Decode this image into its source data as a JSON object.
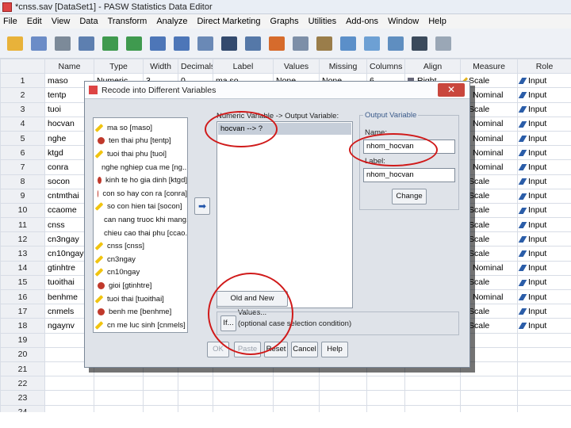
{
  "window": {
    "title": "*cnss.sav [DataSet1] - PASW Statistics Data Editor"
  },
  "menu": [
    "File",
    "Edit",
    "View",
    "Data",
    "Transform",
    "Analyze",
    "Direct Marketing",
    "Graphs",
    "Utilities",
    "Add-ons",
    "Window",
    "Help"
  ],
  "toolbar": {
    "icons": [
      "open-icon",
      "save-icon",
      "print-icon",
      "recall-dialog-icon",
      "undo-icon",
      "redo-icon",
      "goto-case-icon",
      "goto-variable-icon",
      "variables-icon",
      "find-icon",
      "insert-cases-icon",
      "insert-variable-icon",
      "split-file-icon",
      "weight-cases-icon",
      "select-cases-icon",
      "value-labels-icon",
      "use-sets-icon",
      "show-all-icon",
      "spelling-icon"
    ]
  },
  "grid": {
    "headers": [
      "",
      "Name",
      "Type",
      "Width",
      "Decimals",
      "Label",
      "Values",
      "Missing",
      "Columns",
      "Align",
      "Measure",
      "Role"
    ],
    "rows": [
      {
        "num": "1",
        "name": "maso",
        "type": "Numeric",
        "width": "3",
        "decimals": "0",
        "label": "ma so",
        "values": "None",
        "missing": "None",
        "columns": "6",
        "align": "Right",
        "measure": "Scale",
        "role": "Input"
      },
      {
        "num": "2",
        "name": "tentp",
        "type": "",
        "width": "",
        "decimals": "",
        "label": "",
        "values": "",
        "missing": "",
        "columns": "",
        "align": "",
        "measure": "Nominal",
        "role": "Input"
      },
      {
        "num": "3",
        "name": "tuoi",
        "type": "",
        "width": "",
        "decimals": "",
        "label": "",
        "values": "",
        "missing": "",
        "columns": "",
        "align": "",
        "measure": "Scale",
        "role": "Input"
      },
      {
        "num": "4",
        "name": "hocvan",
        "type": "",
        "width": "",
        "decimals": "",
        "label": "",
        "values": "",
        "missing": "",
        "columns": "",
        "align": "",
        "measure": "Nominal",
        "role": "Input"
      },
      {
        "num": "5",
        "name": "nghe",
        "type": "",
        "width": "",
        "decimals": "",
        "label": "",
        "values": "",
        "missing": "",
        "columns": "",
        "align": "",
        "measure": "Nominal",
        "role": "Input"
      },
      {
        "num": "6",
        "name": "ktgd",
        "type": "",
        "width": "",
        "decimals": "",
        "label": "",
        "values": "",
        "missing": "",
        "columns": "",
        "align": "",
        "measure": "Nominal",
        "role": "Input"
      },
      {
        "num": "7",
        "name": "conra",
        "type": "",
        "width": "",
        "decimals": "",
        "label": "",
        "values": "",
        "missing": "",
        "columns": "",
        "align": "",
        "measure": "Nominal",
        "role": "Input"
      },
      {
        "num": "8",
        "name": "socon",
        "type": "",
        "width": "",
        "decimals": "",
        "label": "",
        "values": "",
        "missing": "",
        "columns": "",
        "align": "",
        "measure": "Scale",
        "role": "Input"
      },
      {
        "num": "9",
        "name": "cntmthai",
        "type": "",
        "width": "",
        "decimals": "",
        "label": "",
        "values": "",
        "missing": "",
        "columns": "",
        "align": "",
        "measure": "Scale",
        "role": "Input"
      },
      {
        "num": "10",
        "name": "ccaome",
        "type": "",
        "width": "",
        "decimals": "",
        "label": "",
        "values": "",
        "missing": "",
        "columns": "",
        "align": "",
        "measure": "Scale",
        "role": "Input"
      },
      {
        "num": "11",
        "name": "cnss",
        "type": "",
        "width": "",
        "decimals": "",
        "label": "",
        "values": "",
        "missing": "",
        "columns": "",
        "align": "",
        "measure": "Scale",
        "role": "Input"
      },
      {
        "num": "12",
        "name": "cn3ngay",
        "type": "",
        "width": "",
        "decimals": "",
        "label": "",
        "values": "",
        "missing": "",
        "columns": "",
        "align": "",
        "measure": "Scale",
        "role": "Input"
      },
      {
        "num": "13",
        "name": "cn10ngay",
        "type": "",
        "width": "",
        "decimals": "",
        "label": "",
        "values": "",
        "missing": "",
        "columns": "",
        "align": "",
        "measure": "Scale",
        "role": "Input"
      },
      {
        "num": "14",
        "name": "gtinhtre",
        "type": "",
        "width": "",
        "decimals": "",
        "label": "",
        "values": "",
        "missing": "",
        "columns": "",
        "align": "",
        "measure": "Nominal",
        "role": "Input"
      },
      {
        "num": "15",
        "name": "tuoithai",
        "type": "",
        "width": "",
        "decimals": "",
        "label": "",
        "values": "",
        "missing": "",
        "columns": "",
        "align": "",
        "measure": "Scale",
        "role": "Input"
      },
      {
        "num": "16",
        "name": "benhme",
        "type": "",
        "width": "",
        "decimals": "",
        "label": "",
        "values": "",
        "missing": "",
        "columns": "",
        "align": "",
        "measure": "Nominal",
        "role": "Input"
      },
      {
        "num": "17",
        "name": "cnmels",
        "type": "",
        "width": "",
        "decimals": "",
        "label": "",
        "values": "",
        "missing": "",
        "columns": "",
        "align": "",
        "measure": "Scale",
        "role": "Input"
      },
      {
        "num": "18",
        "name": "ngaynv",
        "type": "",
        "width": "",
        "decimals": "",
        "label": "",
        "values": "",
        "missing": "",
        "columns": "",
        "align": "",
        "measure": "Scale",
        "role": "Input"
      },
      {
        "num": "19"
      },
      {
        "num": "20"
      },
      {
        "num": "21"
      },
      {
        "num": "22"
      },
      {
        "num": "23"
      },
      {
        "num": "24"
      }
    ]
  },
  "dialog": {
    "title": "Recode into Different Variables",
    "close_label": "✕",
    "variables": [
      {
        "label": "ma so [maso]",
        "measure": "scale"
      },
      {
        "label": "ten thai phu [tentp]",
        "measure": "nominal"
      },
      {
        "label": "tuoi thai phu [tuoi]",
        "measure": "scale"
      },
      {
        "label": "nghe nghiep cua me [ng...",
        "measure": "nominal"
      },
      {
        "label": "kinh te ho gia dinh [ktgd]",
        "measure": "nominal"
      },
      {
        "label": "con so hay con ra [conra]",
        "measure": "nominal"
      },
      {
        "label": "so con hien tai [socon]",
        "measure": "scale"
      },
      {
        "label": "can nang truoc khi mang...",
        "measure": "scale"
      },
      {
        "label": "chieu cao thai phu [ccao...",
        "measure": "scale"
      },
      {
        "label": "cnss [cnss]",
        "measure": "scale"
      },
      {
        "label": "cn3ngay",
        "measure": "scale"
      },
      {
        "label": "cn10ngay",
        "measure": "scale"
      },
      {
        "label": "gioi [gtinhtre]",
        "measure": "nominal"
      },
      {
        "label": "tuoi thai [tuoithai]",
        "measure": "scale"
      },
      {
        "label": "benh me [benhme]",
        "measure": "nominal"
      },
      {
        "label": "cn me luc sinh [cnmels]",
        "measure": "scale"
      },
      {
        "label": "ngay nam vien [ngaynv]",
        "measure": "scale"
      }
    ],
    "numeric_output_label": "Numeric Variable -> Output Variable:",
    "mapping": "hocvan --> ?",
    "output_group_label": "Output Variable",
    "name_label": "Name:",
    "name_value": "nhom_hocvan",
    "label_label": "Label:",
    "label_value": "nhom_hocvan",
    "change_button": "Change",
    "old_new_button": "Old and New Values...",
    "if_button": "If...",
    "if_text": "(optional case selection condition)",
    "ok_button": "OK",
    "paste_button": "Paste",
    "reset_button": "Reset",
    "cancel_button": "Cancel",
    "help_button": "Help"
  }
}
